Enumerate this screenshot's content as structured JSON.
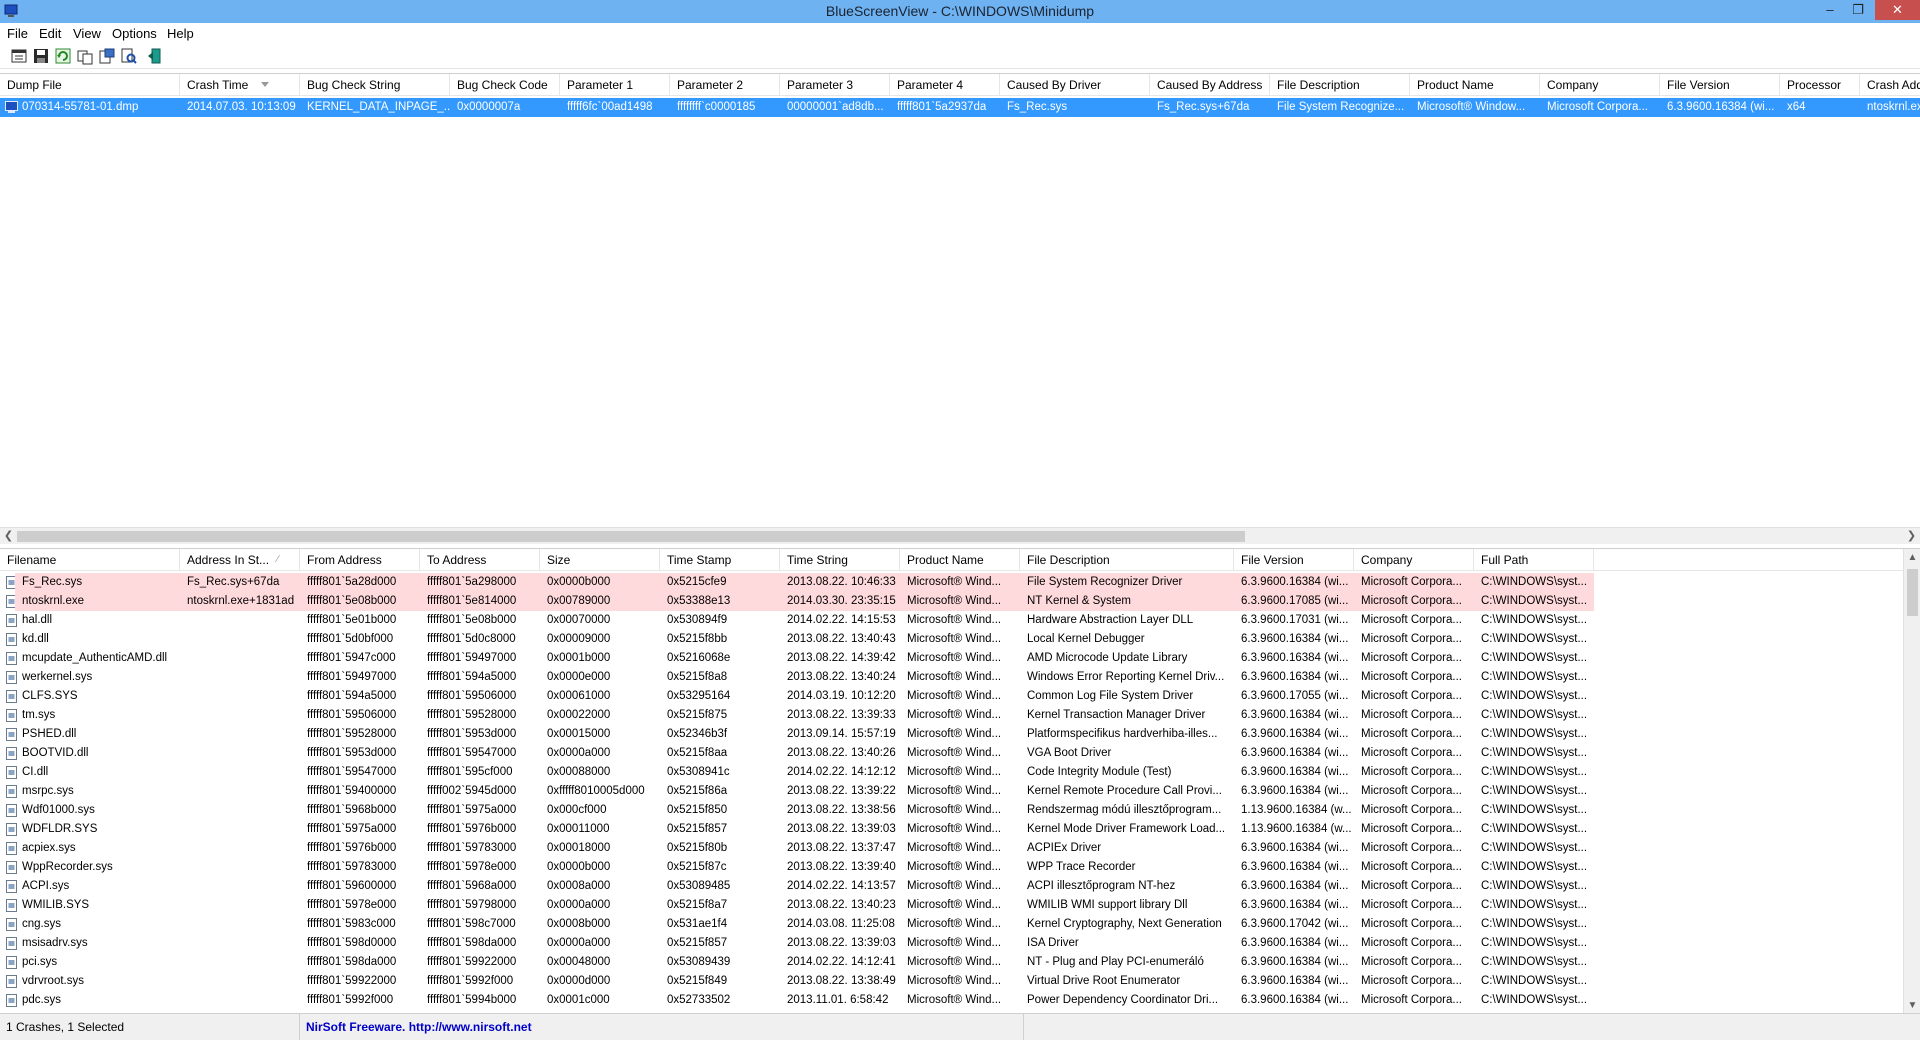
{
  "window": {
    "title": "BlueScreenView  -  C:\\WINDOWS\\Minidump",
    "minimize": "–",
    "restore": "❐",
    "close": "✕"
  },
  "menu": [
    "File",
    "Edit",
    "View",
    "Options",
    "Help"
  ],
  "toolbar": [
    "properties-icon",
    "save-icon",
    "refresh-icon",
    "copy-icon",
    "html-report-icon",
    "find-icon",
    "exit-icon"
  ],
  "dumps": {
    "columns": [
      "Dump File",
      "Crash Time",
      "Bug Check String",
      "Bug Check Code",
      "Parameter 1",
      "Parameter 2",
      "Parameter 3",
      "Parameter 4",
      "Caused By Driver",
      "Caused By Address",
      "File Description",
      "Product Name",
      "Company",
      "File Version",
      "Processor",
      "Crash Address"
    ],
    "rows": [
      [
        "070314-55781-01.dmp",
        "2014.07.03. 10:13:09",
        "KERNEL_DATA_INPAGE_...",
        "0x0000007a",
        "fffff6fc`00ad1498",
        "ffffffff`c0000185",
        "00000001`ad8db...",
        "fffff801`5a2937da",
        "Fs_Rec.sys",
        "Fs_Rec.sys+67da",
        "File System Recognize...",
        "Microsoft® Window...",
        "Microsoft Corpora...",
        "6.3.9600.16384 (wi...",
        "x64",
        "ntoskrnl.exe"
      ]
    ]
  },
  "drivers": {
    "columns": [
      "Filename",
      "Address In St...",
      "From Address",
      "To Address",
      "Size",
      "Time Stamp",
      "Time String",
      "Product Name",
      "File Description",
      "File Version",
      "Company",
      "Full Path"
    ],
    "rows": [
      [
        "Fs_Rec.sys",
        "Fs_Rec.sys+67da",
        "fffff801`5a28d000",
        "fffff801`5a298000",
        "0x0000b000",
        "0x5215cfe9",
        "2013.08.22. 10:46:33",
        "Microsoft® Wind...",
        "File System Recognizer Driver",
        "6.3.9600.16384 (wi...",
        "Microsoft Corpora...",
        "C:\\WINDOWS\\syst..."
      ],
      [
        "ntoskrnl.exe",
        "ntoskrnl.exe+1831ad",
        "fffff801`5e08b000",
        "fffff801`5e814000",
        "0x00789000",
        "0x53388e13",
        "2014.03.30. 23:35:15",
        "Microsoft® Wind...",
        "NT Kernel & System",
        "6.3.9600.17085 (wi...",
        "Microsoft Corpora...",
        "C:\\WINDOWS\\syst..."
      ],
      [
        "hal.dll",
        "",
        "fffff801`5e01b000",
        "fffff801`5e08b000",
        "0x00070000",
        "0x530894f9",
        "2014.02.22. 14:15:53",
        "Microsoft® Wind...",
        "Hardware Abstraction Layer DLL",
        "6.3.9600.17031 (wi...",
        "Microsoft Corpora...",
        "C:\\WINDOWS\\syst..."
      ],
      [
        "kd.dll",
        "",
        "fffff801`5d0bf000",
        "fffff801`5d0c8000",
        "0x00009000",
        "0x5215f8bb",
        "2013.08.22. 13:40:43",
        "Microsoft® Wind...",
        "Local Kernel Debugger",
        "6.3.9600.16384 (wi...",
        "Microsoft Corpora...",
        "C:\\WINDOWS\\syst..."
      ],
      [
        "mcupdate_AuthenticAMD.dll",
        "",
        "fffff801`5947c000",
        "fffff801`59497000",
        "0x0001b000",
        "0x5216068e",
        "2013.08.22. 14:39:42",
        "Microsoft® Wind...",
        "AMD Microcode Update Library",
        "6.3.9600.16384 (wi...",
        "Microsoft Corpora...",
        "C:\\WINDOWS\\syst..."
      ],
      [
        "werkernel.sys",
        "",
        "fffff801`59497000",
        "fffff801`594a5000",
        "0x0000e000",
        "0x5215f8a8",
        "2013.08.22. 13:40:24",
        "Microsoft® Wind...",
        "Windows Error Reporting Kernel Driv...",
        "6.3.9600.16384 (wi...",
        "Microsoft Corpora...",
        "C:\\WINDOWS\\syst..."
      ],
      [
        "CLFS.SYS",
        "",
        "fffff801`594a5000",
        "fffff801`59506000",
        "0x00061000",
        "0x53295164",
        "2014.03.19. 10:12:20",
        "Microsoft® Wind...",
        "Common Log File System Driver",
        "6.3.9600.17055 (wi...",
        "Microsoft Corpora...",
        "C:\\WINDOWS\\syst..."
      ],
      [
        "tm.sys",
        "",
        "fffff801`59506000",
        "fffff801`59528000",
        "0x00022000",
        "0x5215f875",
        "2013.08.22. 13:39:33",
        "Microsoft® Wind...",
        "Kernel Transaction Manager Driver",
        "6.3.9600.16384 (wi...",
        "Microsoft Corpora...",
        "C:\\WINDOWS\\syst..."
      ],
      [
        "PSHED.dll",
        "",
        "fffff801`59528000",
        "fffff801`5953d000",
        "0x00015000",
        "0x52346b3f",
        "2013.09.14. 15:57:19",
        "Microsoft® Wind...",
        "Platformspecifikus hardverhiba-illes...",
        "6.3.9600.16384 (wi...",
        "Microsoft Corpora...",
        "C:\\WINDOWS\\syst..."
      ],
      [
        "BOOTVID.dll",
        "",
        "fffff801`5953d000",
        "fffff801`59547000",
        "0x0000a000",
        "0x5215f8aa",
        "2013.08.22. 13:40:26",
        "Microsoft® Wind...",
        "VGA Boot Driver",
        "6.3.9600.16384 (wi...",
        "Microsoft Corpora...",
        "C:\\WINDOWS\\syst..."
      ],
      [
        "CI.dll",
        "",
        "fffff801`59547000",
        "fffff801`595cf000",
        "0x00088000",
        "0x5308941c",
        "2014.02.22. 14:12:12",
        "Microsoft® Wind...",
        "Code Integrity Module (Test)",
        "6.3.9600.16384 (wi...",
        "Microsoft Corpora...",
        "C:\\WINDOWS\\syst..."
      ],
      [
        "msrpc.sys",
        "",
        "fffff801`59400000",
        "fffff002`5945d000",
        "0xfffff8010005d000",
        "0x5215f86a",
        "2013.08.22. 13:39:22",
        "Microsoft® Wind...",
        "Kernel Remote Procedure Call Provi...",
        "6.3.9600.16384 (wi...",
        "Microsoft Corpora...",
        "C:\\WINDOWS\\syst..."
      ],
      [
        "Wdf01000.sys",
        "",
        "fffff801`5968b000",
        "fffff801`5975a000",
        "0x000cf000",
        "0x5215f850",
        "2013.08.22. 13:38:56",
        "Microsoft® Wind...",
        "Rendszermag módú illesztőprogram...",
        "1.13.9600.16384 (w...",
        "Microsoft Corpora...",
        "C:\\WINDOWS\\syst..."
      ],
      [
        "WDFLDR.SYS",
        "",
        "fffff801`5975a000",
        "fffff801`5976b000",
        "0x00011000",
        "0x5215f857",
        "2013.08.22. 13:39:03",
        "Microsoft® Wind...",
        "Kernel Mode Driver Framework Load...",
        "1.13.9600.16384 (w...",
        "Microsoft Corpora...",
        "C:\\WINDOWS\\syst..."
      ],
      [
        "acpiex.sys",
        "",
        "fffff801`5976b000",
        "fffff801`59783000",
        "0x00018000",
        "0x5215f80b",
        "2013.08.22. 13:37:47",
        "Microsoft® Wind...",
        "ACPIEx Driver",
        "6.3.9600.16384 (wi...",
        "Microsoft Corpora...",
        "C:\\WINDOWS\\syst..."
      ],
      [
        "WppRecorder.sys",
        "",
        "fffff801`59783000",
        "fffff801`5978e000",
        "0x0000b000",
        "0x5215f87c",
        "2013.08.22. 13:39:40",
        "Microsoft® Wind...",
        "WPP Trace Recorder",
        "6.3.9600.16384 (wi...",
        "Microsoft Corpora...",
        "C:\\WINDOWS\\syst..."
      ],
      [
        "ACPI.sys",
        "",
        "fffff801`59600000",
        "fffff801`5968a000",
        "0x0008a000",
        "0x53089485",
        "2014.02.22. 14:13:57",
        "Microsoft® Wind...",
        "ACPI illesztőprogram NT-hez",
        "6.3.9600.16384 (wi...",
        "Microsoft Corpora...",
        "C:\\WINDOWS\\syst..."
      ],
      [
        "WMILIB.SYS",
        "",
        "fffff801`5978e000",
        "fffff801`59798000",
        "0x0000a000",
        "0x5215f8a7",
        "2013.08.22. 13:40:23",
        "Microsoft® Wind...",
        "WMILIB WMI support library Dll",
        "6.3.9600.16384 (wi...",
        "Microsoft Corpora...",
        "C:\\WINDOWS\\syst..."
      ],
      [
        "cng.sys",
        "",
        "fffff801`5983c000",
        "fffff801`598c7000",
        "0x0008b000",
        "0x531ae1f4",
        "2014.03.08. 11:25:08",
        "Microsoft® Wind...",
        "Kernel Cryptography, Next Generation",
        "6.3.9600.17042 (wi...",
        "Microsoft Corpora...",
        "C:\\WINDOWS\\syst..."
      ],
      [
        "msisadrv.sys",
        "",
        "fffff801`598d0000",
        "fffff801`598da000",
        "0x0000a000",
        "0x5215f857",
        "2013.08.22. 13:39:03",
        "Microsoft® Wind...",
        "ISA Driver",
        "6.3.9600.16384 (wi...",
        "Microsoft Corpora...",
        "C:\\WINDOWS\\syst..."
      ],
      [
        "pci.sys",
        "",
        "fffff801`598da000",
        "fffff801`59922000",
        "0x00048000",
        "0x53089439",
        "2014.02.22. 14:12:41",
        "Microsoft® Wind...",
        "NT - Plug and Play PCI-enumeráló",
        "6.3.9600.16384 (wi...",
        "Microsoft Corpora...",
        "C:\\WINDOWS\\syst..."
      ],
      [
        "vdrvroot.sys",
        "",
        "fffff801`59922000",
        "fffff801`5992f000",
        "0x0000d000",
        "0x5215f849",
        "2013.08.22. 13:38:49",
        "Microsoft® Wind...",
        "Virtual Drive Root Enumerator",
        "6.3.9600.16384 (wi...",
        "Microsoft Corpora...",
        "C:\\WINDOWS\\syst..."
      ],
      [
        "pdc.sys",
        "",
        "fffff801`5992f000",
        "fffff801`5994b000",
        "0x0001c000",
        "0x52733502",
        "2013.11.01. 6:58:42",
        "Microsoft® Wind...",
        "Power Dependency Coordinator Dri...",
        "6.3.9600.16384 (wi...",
        "Microsoft Corpora...",
        "C:\\WINDOWS\\syst..."
      ]
    ]
  },
  "status": {
    "count": "1 Crashes, 1 Selected",
    "freeware": "NirSoft Freeware.  http://www.nirsoft.net"
  },
  "colors": {
    "titlebar": "#6fb2f2",
    "selected_row": "#3399ff",
    "highlight_row": "#ffdadc"
  }
}
